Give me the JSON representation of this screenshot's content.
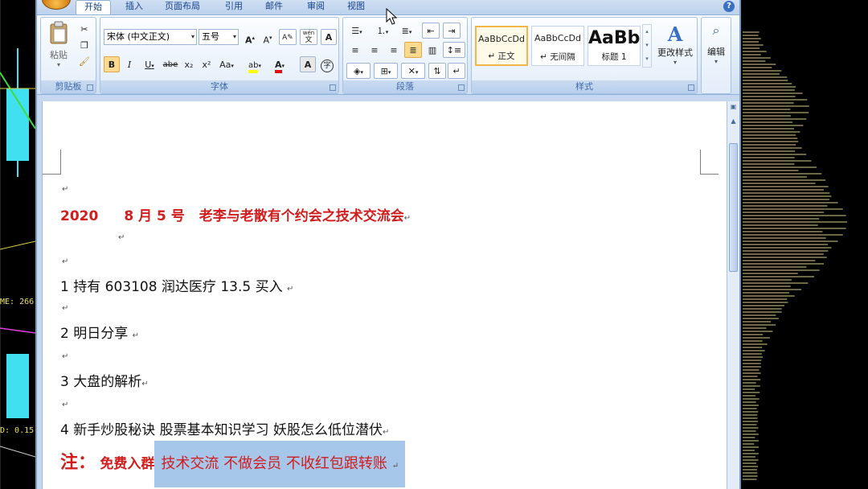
{
  "tabs": [
    "开始",
    "插入",
    "页面布局",
    "引用",
    "邮件",
    "审阅",
    "视图"
  ],
  "active_tab": "开始",
  "clipboard": {
    "paste_label": "粘贴",
    "group_label": "剪贴板"
  },
  "font": {
    "font_name": "宋体 (中文正文)",
    "font_size": "五号",
    "bold": "B",
    "italic": "I",
    "underline": "U",
    "strike": "abe",
    "subscript": "x₂",
    "superscript": "x²",
    "change_case": "Aa",
    "phonetic": "wén",
    "enclosed": "字",
    "group_label": "字体"
  },
  "paragraph": {
    "group_label": "段落"
  },
  "styles": {
    "cards": [
      {
        "sample": "AaBbCcDd",
        "name": "↵ 正文",
        "selected": true
      },
      {
        "sample": "AaBbCcDd",
        "name": "↵ 无间隔",
        "selected": false
      },
      {
        "sample": "AaBb",
        "name": "标题 1",
        "selected": false
      }
    ],
    "change_styles": "更改样式",
    "group_label": "样式"
  },
  "editing": {
    "label": "编辑"
  },
  "document": {
    "title_year": "2020",
    "title_date": "8 月 5 号",
    "title_text": "老李与老散有个约会之技术交流会",
    "line1": "1  持有  603108    润达医疗     13.5  买入",
    "line2": "2    明日分享",
    "line3": "3  大盘的解析",
    "line4": "4  新手炒股秘诀  股票基本知识学习  妖股怎么低位潜伏",
    "note_prefix": "注：",
    "note_free": "免费入群",
    "note_highlight": "技术交流 不做会员 不收红包跟转账",
    "para_mark": "↵"
  },
  "background": {
    "label_left": "ME: 266",
    "label_bottom": "D: 0.15"
  }
}
